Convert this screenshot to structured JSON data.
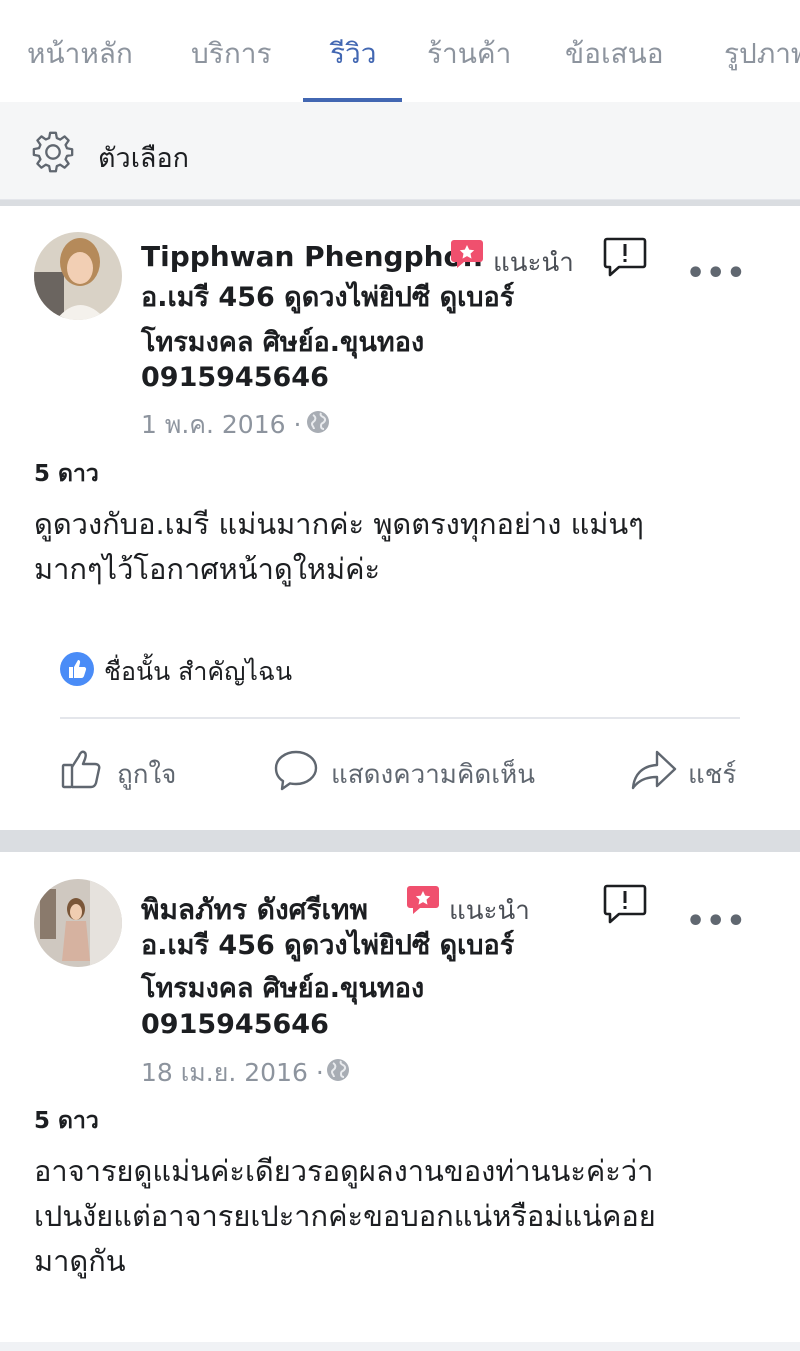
{
  "tabs": [
    {
      "label": "หน้าหลัก",
      "active": false
    },
    {
      "label": "บริการ",
      "active": false
    },
    {
      "label": "รีวิว",
      "active": true
    },
    {
      "label": "ร้านค้า",
      "active": false
    },
    {
      "label": "ข้อเสนอ",
      "active": false
    },
    {
      "label": "รูปภาพ",
      "active": false
    }
  ],
  "options": {
    "label": "ตัวเลือก",
    "icon": "gear-icon"
  },
  "reviews": [
    {
      "author": "Tipphwan Phengphon",
      "recommend": "แนะนำ",
      "page_lines": [
        "อ.เมรี 456 ดูดวงไพ่ยิปซี ดูเบอร์",
        "โทรมงคล ศิษย์อ.ขุนทอง",
        "0915945646"
      ],
      "date": "1 พ.ค. 2016 ·",
      "rating": "5 ดาว",
      "text_lines": [
        "ดูดวงกับอ.เมรี แม่นมากค่ะ พูดตรงทุกอย่าง แม่นๆ",
        "มากๆไว้โอกาศหน้าดูใหม่ค่ะ"
      ],
      "liked_by": "ชื่อนั้น สำคัญไฉน",
      "actions": {
        "like": "ถูกใจ",
        "comment": "แสดงความคิดเห็น",
        "share": "แชร์"
      }
    },
    {
      "author": "พิมลภัทร ดังศรีเทพ",
      "recommend": "แนะนำ",
      "page_lines": [
        "อ.เมรี 456 ดูดวงไพ่ยิปซี ดูเบอร์",
        "โทรมงคล ศิษย์อ.ขุนทอง",
        "0915945646"
      ],
      "date": "18 เม.ย. 2016 ·",
      "rating": "5 ดาว",
      "text_lines": [
        "อาจารยดูแม่นค่ะเดียวรอดูผลงานของท่านนะค่ะว่า",
        "เปนงัยแต่อาจารยเปะากค่ะขอบอกแน่หรือม่แน่คอย",
        "มาดูกัน"
      ]
    }
  ],
  "colors": {
    "accent": "#4267b2",
    "badge": "#f0506e",
    "like_blue": "#4a8cf7",
    "muted": "#8d949e"
  }
}
